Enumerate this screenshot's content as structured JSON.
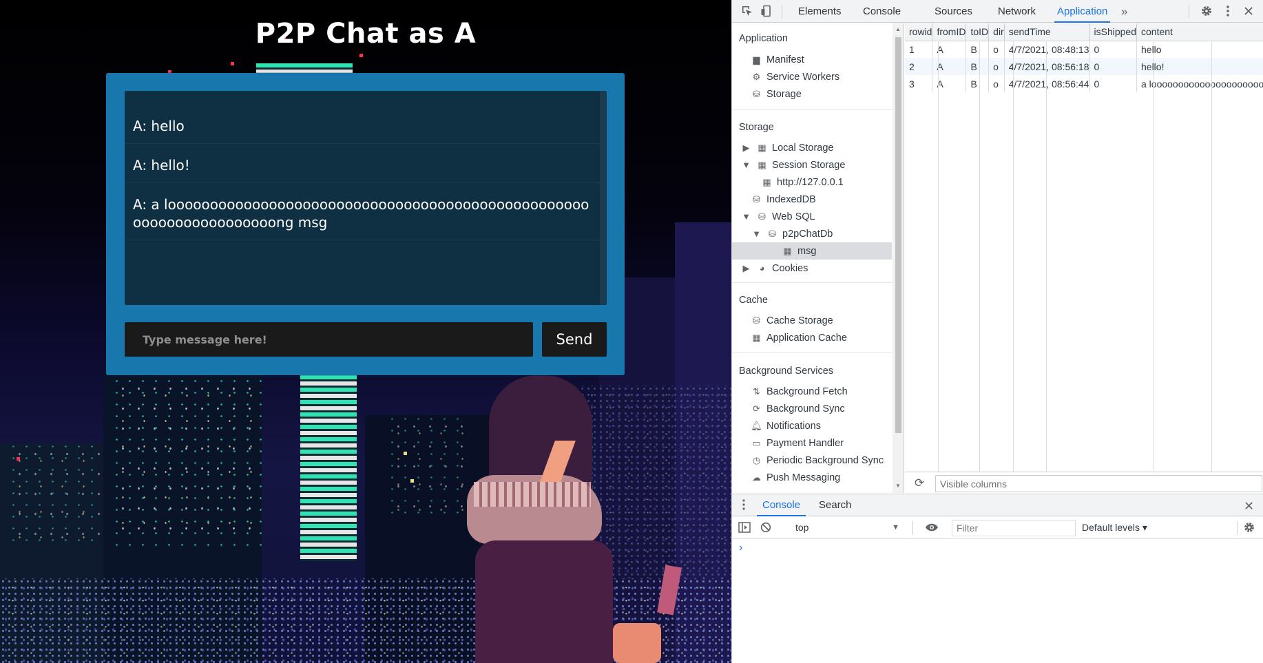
{
  "page": {
    "title": "P2P Chat as A",
    "messages": [
      "A: hello",
      "A: hello!",
      "A: a looooooooooooooooooooooooooooooooooooooooooooooooooooooooooooooooooong msg"
    ],
    "input_placeholder": "Type message here!",
    "send_label": "Send"
  },
  "devtools": {
    "tabs": [
      "Elements",
      "Console",
      "Sources",
      "Network",
      "Application"
    ],
    "active_tab": "Application",
    "more_tabs_glyph": "»",
    "sidebar": {
      "application_header": "Application",
      "application_items": [
        "Manifest",
        "Service Workers",
        "Storage"
      ],
      "storage_header": "Storage",
      "storage_items": [
        "Local Storage",
        "Session Storage",
        "http://127.0.0.1",
        "IndexedDB",
        "Web SQL",
        "p2pChatDb",
        "msg",
        "Cookies"
      ],
      "cache_header": "Cache",
      "cache_items": [
        "Cache Storage",
        "Application Cache"
      ],
      "bg_header": "Background Services",
      "bg_items": [
        "Background Fetch",
        "Background Sync",
        "Notifications",
        "Payment Handler",
        "Periodic Background Sync",
        "Push Messaging"
      ]
    },
    "table": {
      "columns": [
        "rowid",
        "fromID",
        "toID",
        "dir",
        "sendTime",
        "isShipped",
        "content"
      ],
      "rows": [
        [
          "1",
          "A",
          "B",
          "o",
          "4/7/2021, 08:48:13",
          "0",
          "hello"
        ],
        [
          "2",
          "A",
          "B",
          "o",
          "4/7/2021, 08:56:18",
          "0",
          "hello!"
        ],
        [
          "3",
          "A",
          "B",
          "o",
          "4/7/2021, 08:56:44",
          "0",
          "a looooooooooooooooooooooooooooooooooooooooooooooooooooooooooooooooooong msg"
        ]
      ]
    },
    "visible_columns_placeholder": "Visible columns",
    "drawer": {
      "tabs": [
        "Console",
        "Search"
      ],
      "active_tab": "Console",
      "context": "top",
      "filter_placeholder": "Filter",
      "levels": "Default levels ▾",
      "prompt": "›"
    }
  }
}
